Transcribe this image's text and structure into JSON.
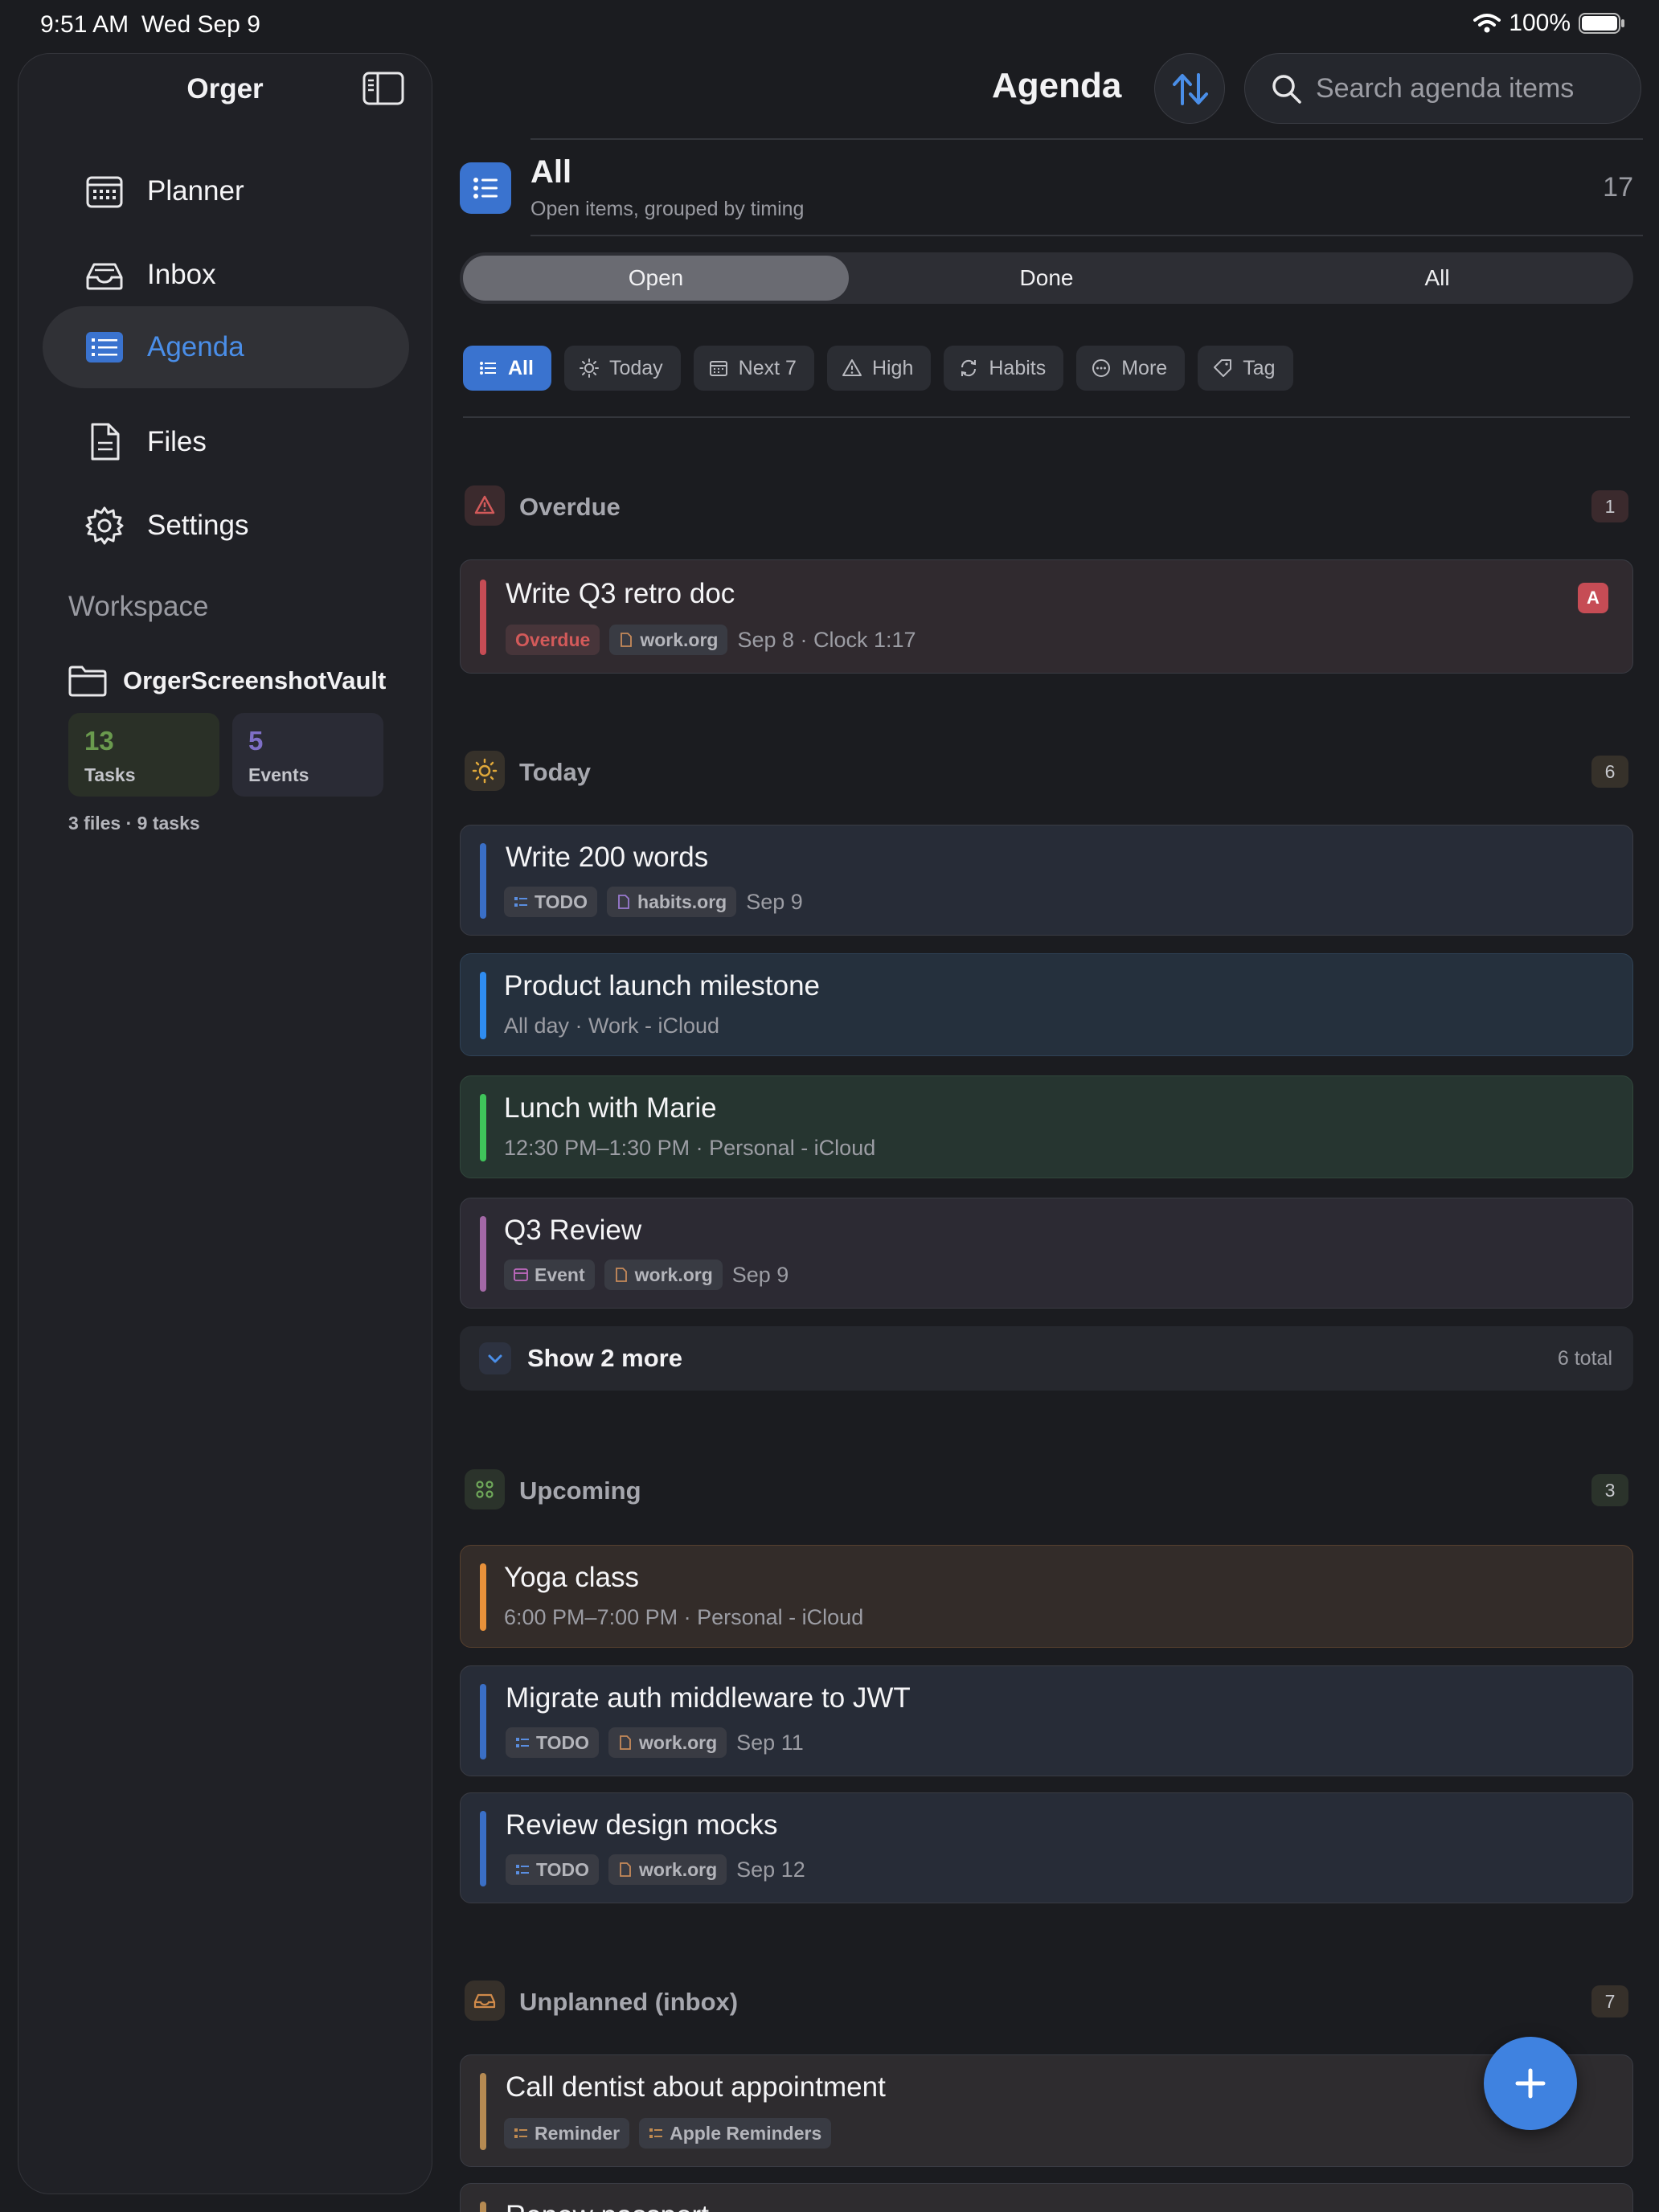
{
  "status_bar": {
    "time": "9:51 AM",
    "date": "Wed Sep 9",
    "battery": "100%"
  },
  "sidebar": {
    "title": "Orger",
    "items": [
      {
        "label": "Planner",
        "icon": "calendar-icon",
        "active": false
      },
      {
        "label": "Inbox",
        "icon": "inbox-tray-icon",
        "active": false
      },
      {
        "label": "Agenda",
        "icon": "agenda-list-icon",
        "active": true
      },
      {
        "label": "Files",
        "icon": "document-icon",
        "active": false
      },
      {
        "label": "Settings",
        "icon": "gear-icon",
        "active": false
      }
    ],
    "workspace_label": "Workspace",
    "workspace_name": "OrgerScreenshotVault",
    "stats": [
      {
        "value": "13",
        "caption": "Tasks",
        "color": "#5a8a44"
      },
      {
        "value": "5",
        "caption": "Events",
        "color": "#7b6cc2"
      }
    ],
    "footer": "3 files · 9 tasks"
  },
  "header": {
    "title": "Agenda",
    "search_placeholder": "Search agenda items"
  },
  "filter_header": {
    "title": "All",
    "subtitle": "Open items, grouped by timing",
    "count": "17"
  },
  "segments": [
    "Open",
    "Done",
    "All"
  ],
  "selected_segment": "Open",
  "chips": [
    "All",
    "Today",
    "Next 7",
    "High",
    "Habits",
    "More",
    "Tag"
  ],
  "sections": {
    "overdue": {
      "title": "Overdue",
      "count": "1"
    },
    "today": {
      "title": "Today",
      "count": "6"
    },
    "upcoming": {
      "title": "Upcoming",
      "count": "3"
    },
    "unplanned": {
      "title": "Unplanned (inbox)",
      "count": "7"
    }
  },
  "items": {
    "retro": {
      "title": "Write Q3 retro doc",
      "status": "Overdue",
      "file": "work.org",
      "meta": "Sep 8 · Clock 1:17",
      "priority": "A"
    },
    "words": {
      "title": "Write 200 words",
      "kind": "TODO",
      "file": "habits.org",
      "meta": "Sep 9"
    },
    "launch": {
      "title": "Product launch milestone",
      "meta": "All day · Work - iCloud"
    },
    "lunch": {
      "title": "Lunch with Marie",
      "meta": "12:30 PM–1:30 PM · Personal - iCloud"
    },
    "review": {
      "title": "Q3 Review",
      "kind": "Event",
      "file": "work.org",
      "meta": "Sep 9"
    },
    "yoga": {
      "title": "Yoga class",
      "meta": "6:00 PM–7:00 PM · Personal - iCloud"
    },
    "migrate": {
      "title": "Migrate auth middleware to JWT",
      "kind": "TODO",
      "file": "work.org",
      "meta": "Sep 11"
    },
    "mocks": {
      "title": "Review design mocks",
      "kind": "TODO",
      "file": "work.org",
      "meta": "Sep 12"
    },
    "dentist": {
      "title": "Call dentist about appointment",
      "kind": "Reminder",
      "source": "Apple Reminders"
    },
    "passport": {
      "title": "Renew passport"
    }
  },
  "show_more": {
    "label": "Show 2 more",
    "total": "6 total"
  },
  "colors": {
    "accent": "#3f82e0",
    "overdue": "#c64c55",
    "event_blue": "#2f8cf0",
    "event_green": "#3fc45a",
    "event_purple": "#a368a6",
    "event_orange": "#e8913a",
    "reminder_tan": "#b58a52"
  }
}
